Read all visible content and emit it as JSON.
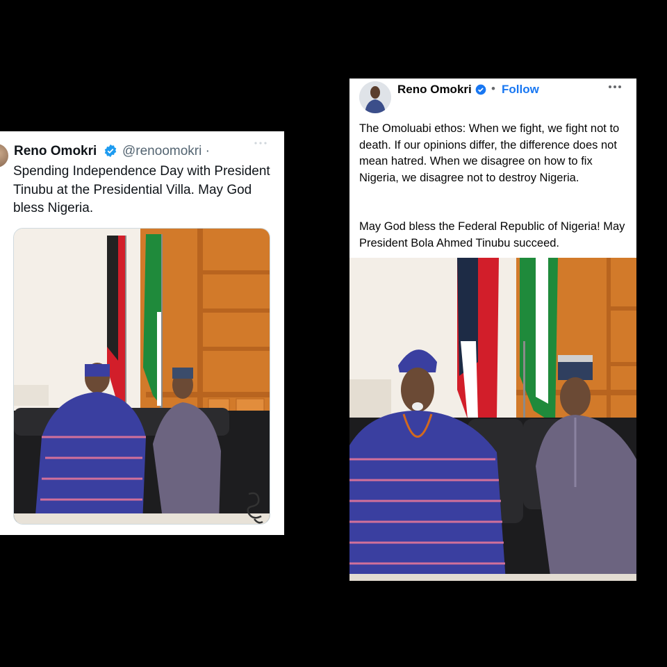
{
  "left_post": {
    "author_name": "Reno Omokri",
    "handle": "@renoomokri ·",
    "text": "Spending Independence Day with President Tinubu at the Presidential Villa. May God bless Nigeria.",
    "more_icon": "ellipsis-icon",
    "verified_icon": "verified-badge-icon",
    "photo_alt": "photo-two-men-in-traditional-attire"
  },
  "right_post": {
    "author_name": "Reno Omokri",
    "follow_label": "Follow",
    "dot": "•",
    "paragraph_1": "The Omoluabi ethos: When we fight, we fight not to death. If our opinions differ, the difference does not mean hatred. When we disagree on how to fix Nigeria, we disagree not to destroy Nigeria.",
    "paragraph_2": "May God bless the Federal Republic of Nigeria! May President Bola Ahmed Tinubu succeed.",
    "more_icon": "ellipsis-icon",
    "verified_icon": "verified-badge-icon"
  },
  "colors": {
    "background": "#000000",
    "twitter_verified": "#1d9bf0",
    "facebook_blue": "#1877f2",
    "wood": "#d27a2a",
    "flag_green": "#1f8a3b",
    "flag_red": "#d21e2a",
    "robe_blue": "#3a3fa0",
    "robe_grey": "#6c6480"
  }
}
